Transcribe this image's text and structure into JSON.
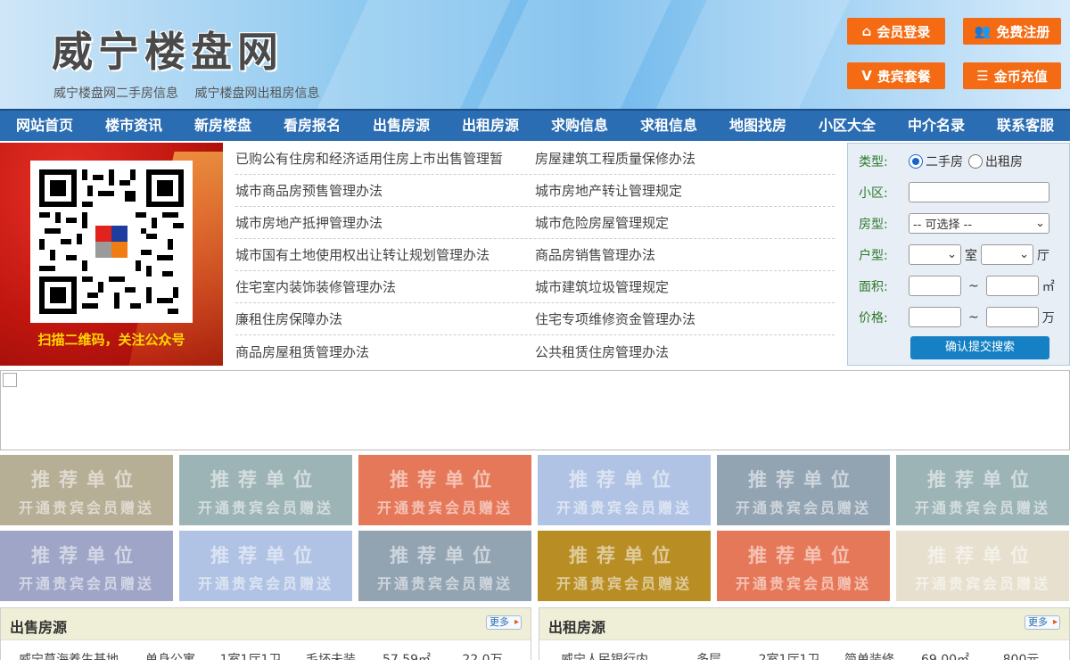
{
  "site": {
    "logo": "威宁楼盘网",
    "sublinks": [
      "威宁楼盘网二手房信息",
      "威宁楼盘网出租房信息"
    ]
  },
  "header_buttons": {
    "login": "会员登录",
    "register": "免费注册",
    "vip": "贵宾套餐",
    "recharge": "金币充值"
  },
  "nav": [
    "网站首页",
    "楼市资讯",
    "新房楼盘",
    "看房报名",
    "出售房源",
    "出租房源",
    "求购信息",
    "求租信息",
    "地图找房",
    "小区大全",
    "中介名录",
    "联系客服"
  ],
  "qr_banner": {
    "caption": "扫描二维码，关注公众号"
  },
  "policies": [
    [
      "已购公有住房和经济适用住房上市出售管理暂",
      "房屋建筑工程质量保修办法"
    ],
    [
      "城市商品房预售管理办法",
      "城市房地产转让管理规定"
    ],
    [
      "城市房地产抵押管理办法",
      "城市危险房屋管理规定"
    ],
    [
      "城市国有土地使用权出让转让规划管理办法",
      "商品房销售管理办法"
    ],
    [
      "住宅室内装饰装修管理办法",
      "城市建筑垃圾管理规定"
    ],
    [
      "廉租住房保障办法",
      "住宅专项维修资金管理办法"
    ],
    [
      "商品房屋租赁管理办法",
      "公共租赁住房管理办法"
    ]
  ],
  "search": {
    "type_label": "类型:",
    "type_options": [
      "二手房",
      "出租房"
    ],
    "type_selected": "二手房",
    "community_label": "小区:",
    "community_value": "",
    "house_type_label": "房型:",
    "house_type_value": "-- 可选择 --",
    "layout_label": "户型:",
    "room_unit": "室",
    "hall_unit": "厅",
    "area_label": "面积:",
    "area_unit": "㎡",
    "price_label": "价格:",
    "price_unit": "万",
    "range_sep": "~",
    "submit": "确认提交搜索"
  },
  "recommend": {
    "title": "推荐单位",
    "subtitle": "开通贵宾会员赠送",
    "colors": [
      "#b7ae96",
      "#9db4b6",
      "#e6785a",
      "#b1c3e4",
      "#92a3b2",
      "#9db4b6",
      "#9ea5c6",
      "#b1c3e4",
      "#92a3b2",
      "#b88d23",
      "#e6785a",
      "#e7e0cf"
    ]
  },
  "sale_panel": {
    "title": "出售房源",
    "more": "更多",
    "row": [
      "威宁草海养生基地",
      "单身公寓",
      "1室1厅1卫",
      "毛坯未装",
      "57.59㎡",
      "22.0万"
    ]
  },
  "rent_panel": {
    "title": "出租房源",
    "more": "更多",
    "row": [
      "威宁人民银行内",
      "多层",
      "2室1厅1卫",
      "简单装修",
      "69.00㎡",
      "800元"
    ]
  }
}
